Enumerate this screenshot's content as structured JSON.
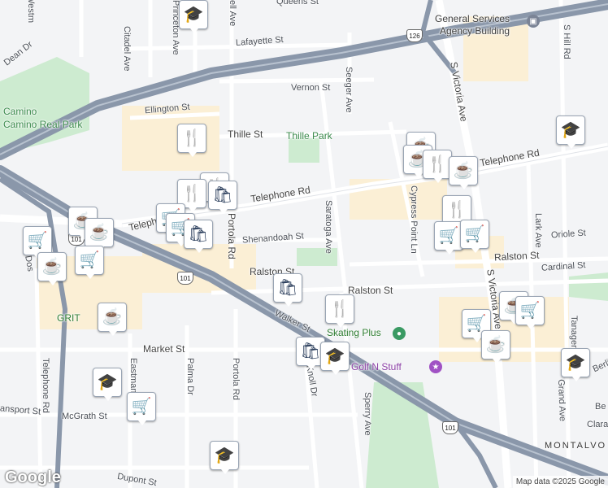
{
  "map": {
    "attribution": "Map data ©2025 Google",
    "logo": "Google",
    "colors": {
      "land": "#f3f4f6",
      "freeway": "#8a97aa",
      "road": "#ffffff",
      "park": "#cdebd0",
      "commercial": "#fbefd5",
      "water": "#a6c8f0"
    },
    "streets": [
      {
        "name": "Queens St"
      },
      {
        "name": "Princeton Ave"
      },
      {
        "name": "Citadel Ave"
      },
      {
        "name": "Lafayette St"
      },
      {
        "name": "Dean Dr"
      },
      {
        "name": "Vernon St"
      },
      {
        "name": "Seeger Ave"
      },
      {
        "name": "Ellington St"
      },
      {
        "name": "Thille St"
      },
      {
        "name": "Telephone Rd"
      },
      {
        "name": "Telephone Rd"
      },
      {
        "name": "Telepho"
      },
      {
        "name": "Saratoga Ave"
      },
      {
        "name": "Shenandoah St"
      },
      {
        "name": "Portola Rd"
      },
      {
        "name": "Ralston St"
      },
      {
        "name": "Ralston St"
      },
      {
        "name": "Cypress Point Ln"
      },
      {
        "name": "S Victoria Ave"
      },
      {
        "name": "S Victoria Ave"
      },
      {
        "name": "S Hill Rd"
      },
      {
        "name": "Lark Ave"
      },
      {
        "name": "Oriole St"
      },
      {
        "name": "Ralston St"
      },
      {
        "name": "Cardinal St"
      },
      {
        "name": "Walker St"
      },
      {
        "name": "Market St"
      },
      {
        "name": "Eastman Ave"
      },
      {
        "name": "Palma Dr"
      },
      {
        "name": "Portola Rd"
      },
      {
        "name": "Knoll Dr"
      },
      {
        "name": "Sperry Ave"
      },
      {
        "name": "McGrath St"
      },
      {
        "name": "Telephone Rd"
      },
      {
        "name": "Dupont St"
      },
      {
        "name": "Transport St"
      },
      {
        "name": "Grand Ave"
      },
      {
        "name": "Tanager St"
      },
      {
        "name": "Dos"
      },
      {
        "name": "Westm"
      },
      {
        "name": "ell Ave"
      },
      {
        "name": "Clara"
      },
      {
        "name": "Be"
      },
      {
        "name": "Berlin St"
      }
    ],
    "places": {
      "camino_real_park": "Camino Real Park",
      "thille_park": "Thille Park",
      "gsa_line1": "General Services",
      "gsa_line2": "Agency Building",
      "grit": "GRIT",
      "skating_plus": "Skating Plus",
      "golf_n_stuff": "Golf N Stuff",
      "montalvo": "MONTALVO"
    },
    "shields": {
      "hwy126": "126",
      "us101_a": "101",
      "us101_b": "101",
      "us101_c": "101"
    }
  }
}
